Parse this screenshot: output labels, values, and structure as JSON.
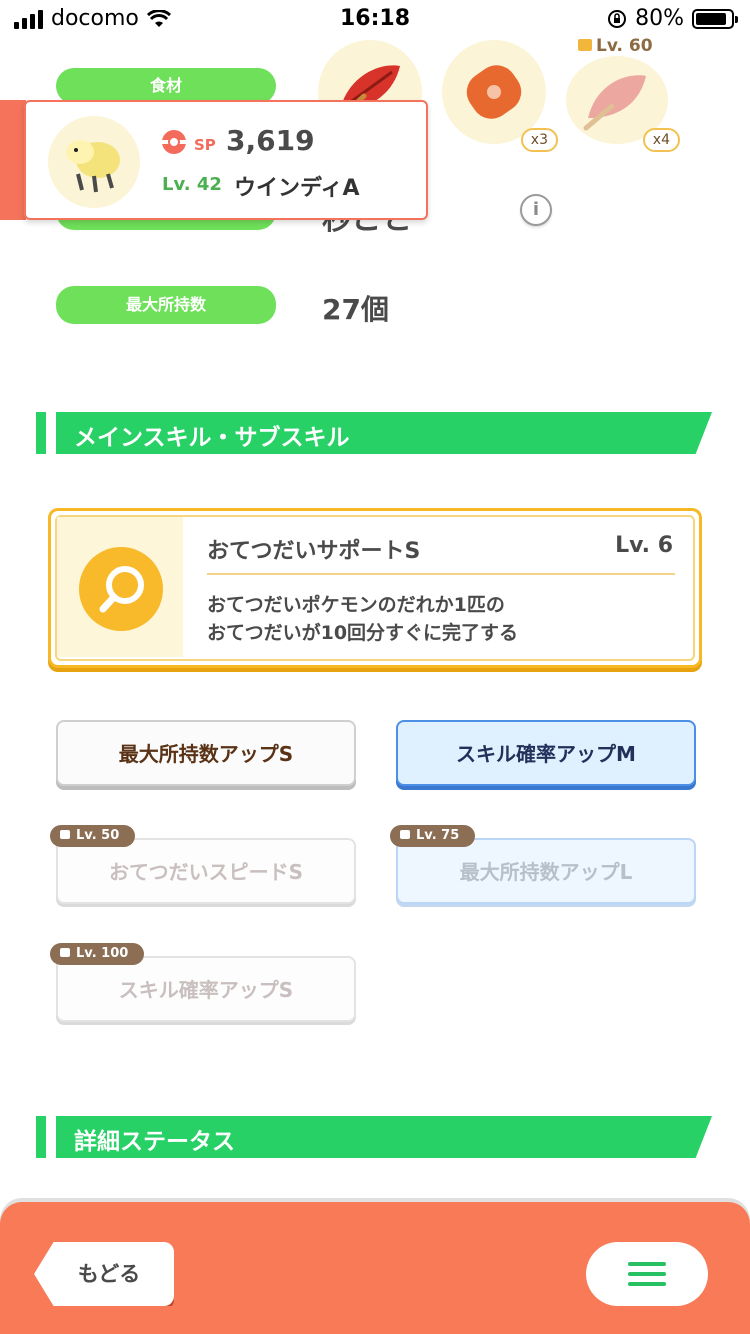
{
  "status_bar": {
    "carrier": "docomo",
    "time": "16:18",
    "battery": "80%"
  },
  "ingredients": {
    "label": "食材",
    "items": [
      {
        "name": "red-leaf",
        "count": ""
      },
      {
        "name": "sausage",
        "count": "x3"
      },
      {
        "name": "red-leaf-locked",
        "count": "x4",
        "lock_level": "Lv. 60"
      }
    ]
  },
  "popup": {
    "sp_label": "SP",
    "sp_value": "3,619",
    "level": "Lv. 42",
    "pokemon_name": "ウインディA"
  },
  "help_interval": {
    "partial_text": "秒ごと"
  },
  "max_carry": {
    "label": "最大所持数",
    "value": "27個"
  },
  "sections": {
    "skills_title": "メインスキル・サブスキル",
    "details_title": "詳細ステータス"
  },
  "main_skill": {
    "name": "おてつだいサポートS",
    "level": "Lv. 6",
    "description_line1": "おてつだいポケモンのだれか1匹の",
    "description_line2": "おてつだいが10回分すぐに完了する"
  },
  "sub_skills": [
    {
      "label": "最大所持数アップS",
      "lock": "",
      "style": "normal"
    },
    {
      "label": "スキル確率アップM",
      "lock": "",
      "style": "gold"
    },
    {
      "label": "おてつだいスピードS",
      "lock": "Lv. 50",
      "style": "locked"
    },
    {
      "label": "最大所持数アップL",
      "lock": "Lv. 75",
      "style": "locked-gold"
    },
    {
      "label": "スキル確率アップS",
      "lock": "Lv. 100",
      "style": "locked"
    }
  ],
  "bottom_bar": {
    "back_label": "もどる"
  }
}
